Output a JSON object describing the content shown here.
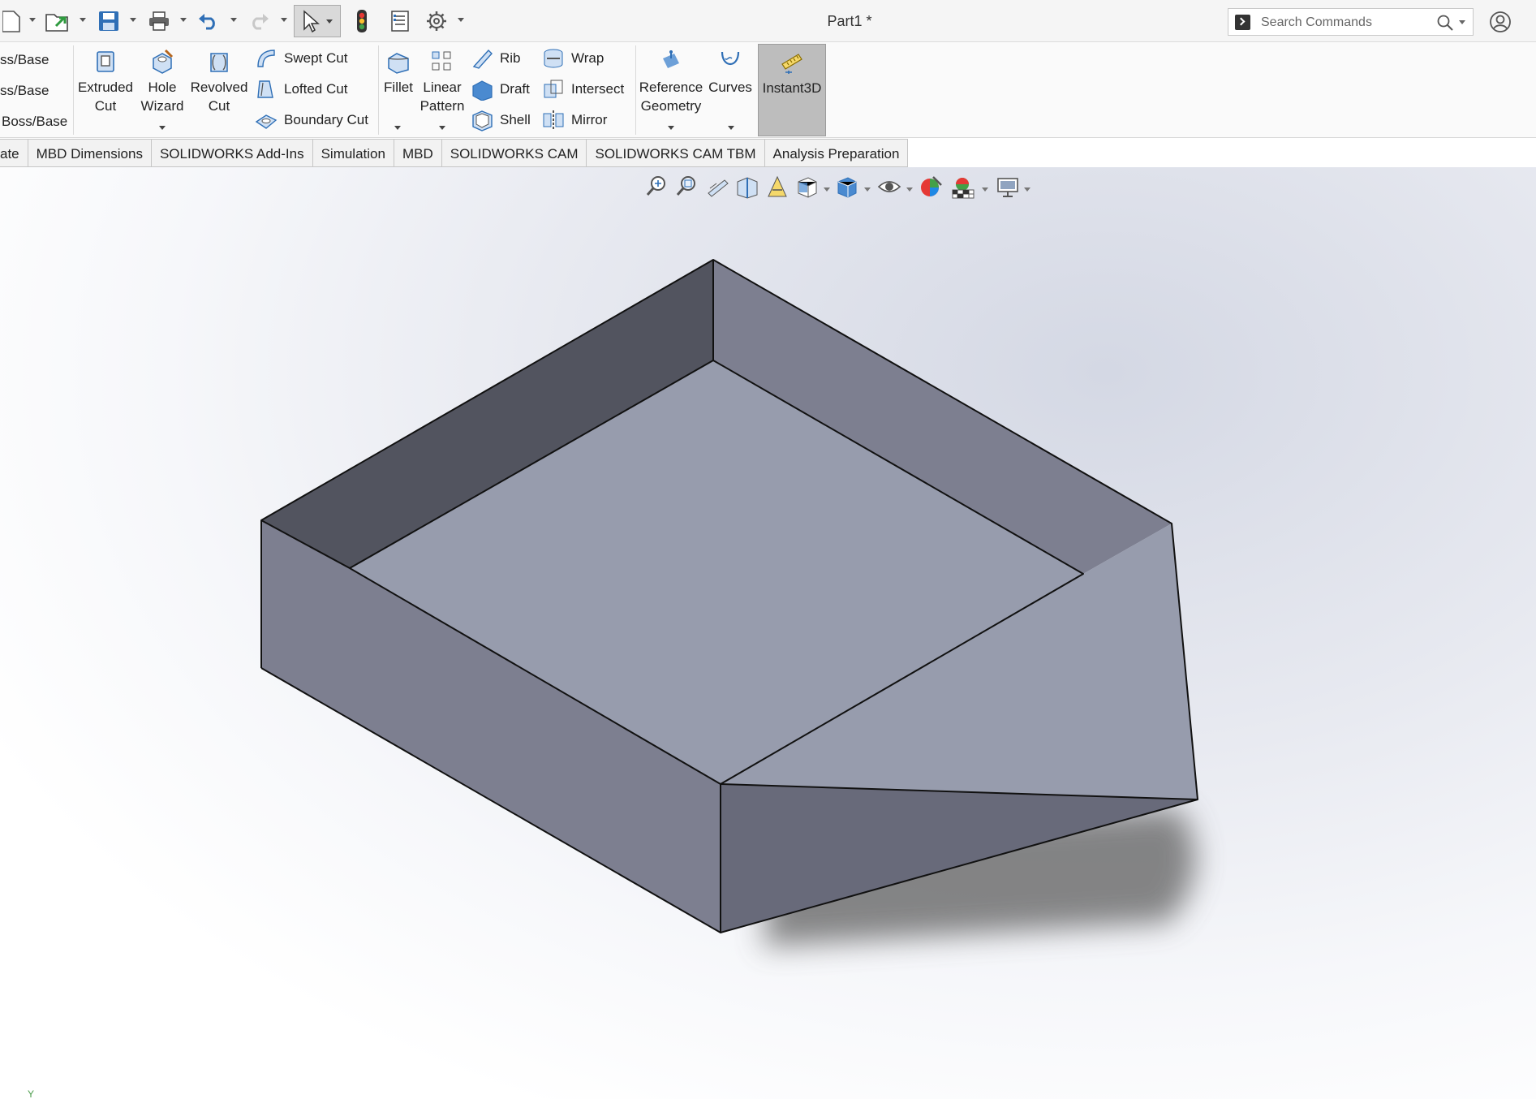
{
  "window": {
    "document_title": "Part1 *"
  },
  "search": {
    "placeholder": "Search Commands"
  },
  "ribbon": {
    "boss_items": [
      "ss/Base",
      "ss/Base",
      "Boss/Base"
    ],
    "extruded_cut": "Extruded\nCut",
    "hole_wizard": "Hole\nWizard",
    "revolved_cut": "Revolved\nCut",
    "swept_cut": "Swept Cut",
    "lofted_cut": "Lofted Cut",
    "boundary_cut": "Boundary Cut",
    "fillet": "Fillet",
    "linear_pattern": "Linear\nPattern",
    "rib": "Rib",
    "draft": "Draft",
    "shell": "Shell",
    "wrap": "Wrap",
    "intersect": "Intersect",
    "mirror": "Mirror",
    "reference_geometry": "Reference\nGeometry",
    "curves": "Curves",
    "instant3d": "Instant3D"
  },
  "tabs": [
    "ate",
    "MBD Dimensions",
    "SOLIDWORKS Add-Ins",
    "Simulation",
    "MBD",
    "SOLIDWORKS CAM",
    "SOLIDWORKS CAM TBM",
    "Analysis Preparation"
  ],
  "viewport": {
    "axis_label": "Y"
  },
  "colors": {
    "accent_blue": "#2f6fb6",
    "part_face_inner": "#979cad",
    "part_face_left_wall": "#52545f",
    "part_face_side": "#7d7f90",
    "part_face_front": "#686a7a",
    "instant3d_active": "#bdbdbd"
  }
}
